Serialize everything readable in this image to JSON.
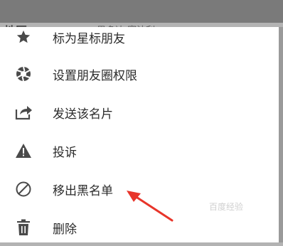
{
  "background": {
    "left_label": "地区",
    "right_label": "恩多达  寒法利"
  },
  "menu": {
    "items": [
      {
        "label": "标为星标朋友",
        "icon": "star-icon"
      },
      {
        "label": "设置朋友圈权限",
        "icon": "aperture-icon"
      },
      {
        "label": "发送该名片",
        "icon": "share-icon"
      },
      {
        "label": "投诉",
        "icon": "warning-icon"
      },
      {
        "label": "移出黑名单",
        "icon": "block-icon"
      },
      {
        "label": "删除",
        "icon": "trash-icon"
      }
    ]
  },
  "watermark": "百度经验",
  "colors": {
    "icon": "#4a4a4a",
    "arrow": "#e8352a",
    "sheet": "#ffffff"
  }
}
